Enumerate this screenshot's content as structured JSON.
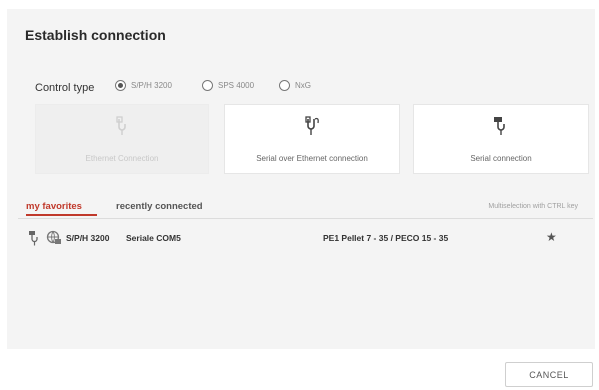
{
  "dialog": {
    "title": "Establish connection"
  },
  "control_type": {
    "label": "Control type",
    "options": [
      {
        "label": "S/P/H 3200",
        "selected": true
      },
      {
        "label": "SPS 4000",
        "selected": false
      },
      {
        "label": "NxG",
        "selected": false
      }
    ]
  },
  "connections": [
    {
      "label": "Ethernet Connection",
      "icon": "ethernet-plug-icon",
      "disabled": true
    },
    {
      "label": "Serial over Ethernet connection",
      "icon": "serial-over-ethernet-plug-icon",
      "disabled": false
    },
    {
      "label": "Serial connection",
      "icon": "serial-plug-icon",
      "disabled": false
    }
  ],
  "tabs": [
    {
      "label": "my favorites",
      "active": true
    },
    {
      "label": "recently connected",
      "active": false
    }
  ],
  "hint": "Multiselection with CTRL key",
  "favorites": [
    {
      "connection_icon": "serial-plug-icon",
      "status_icon": "globe-lock-icon",
      "control": "S/P/H 3200",
      "port": "Seriale COM5",
      "devices": "PE1 Pellet 7 - 35 / PECO 15 - 35",
      "favorite_icon": "star-icon"
    }
  ],
  "footer": {
    "cancel_label": "CANCEL"
  },
  "colors": {
    "accent": "#c0392b",
    "panel_bg": "#f4f4f4"
  }
}
